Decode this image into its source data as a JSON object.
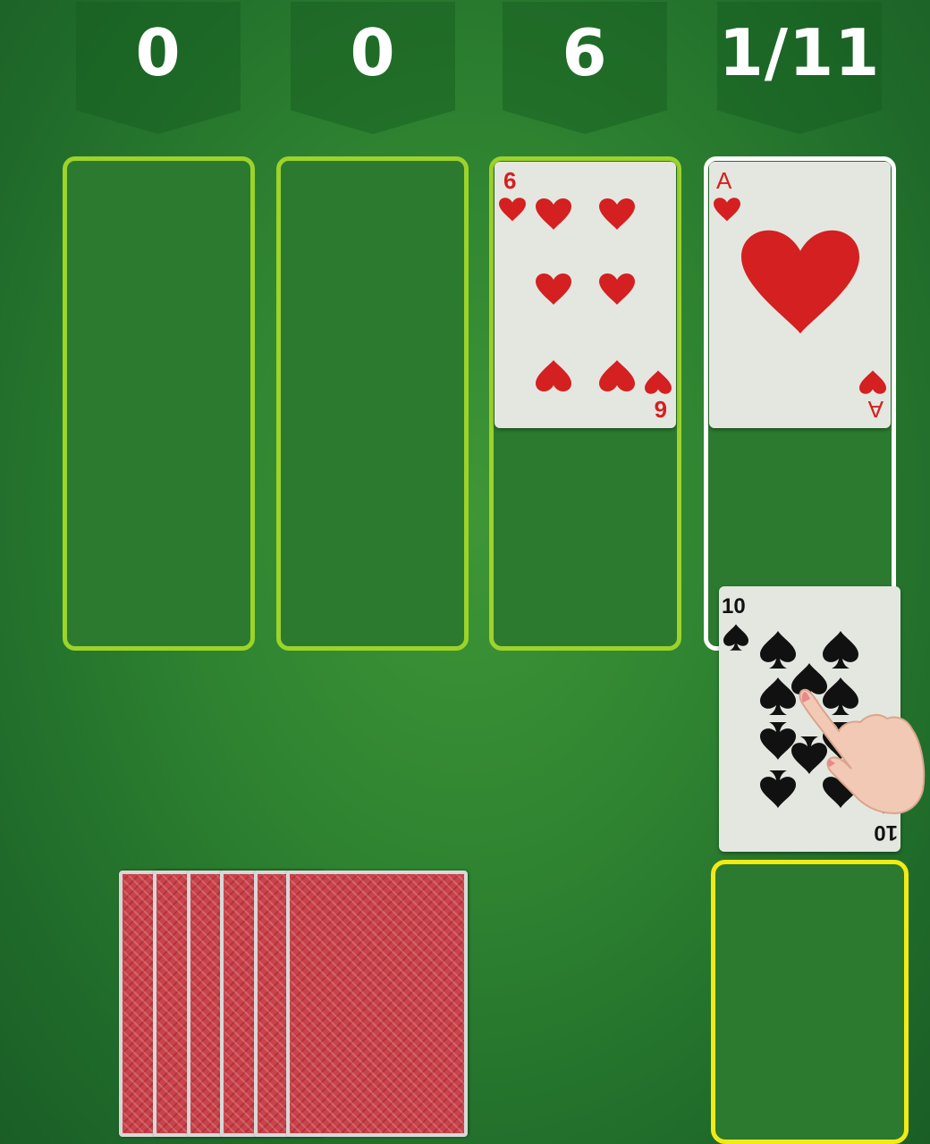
{
  "scores": {
    "s1": "0",
    "s2": "0",
    "s3": "6",
    "s4": "1/11"
  },
  "cards": {
    "six_hearts": {
      "rank": "6",
      "suit": "hearts"
    },
    "ace_hearts": {
      "rank": "A",
      "suit": "hearts"
    },
    "ten_spades": {
      "rank": "10",
      "suit": "spades"
    }
  },
  "stock": {
    "face_down_count": 6
  },
  "colors": {
    "table_green": "#2f8431",
    "slot_border": "#9dd32a",
    "active_slot_border": "#ffffff",
    "waste_slot_border": "#f2ea14",
    "heart_red": "#d42020",
    "spade_black": "#111111",
    "card_back_red": "#c9434b"
  }
}
